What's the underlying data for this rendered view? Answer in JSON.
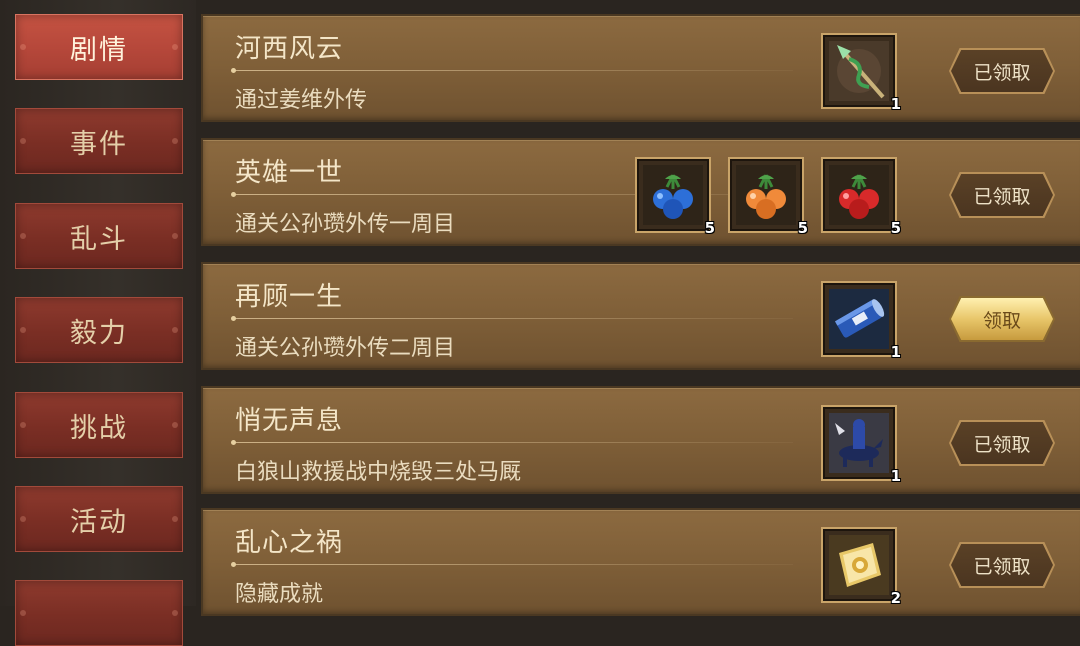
{
  "sidebar": {
    "tabs": [
      {
        "label": "剧情",
        "active": true
      },
      {
        "label": "事件",
        "active": false
      },
      {
        "label": "乱斗",
        "active": false
      },
      {
        "label": "毅力",
        "active": false
      },
      {
        "label": "挑战",
        "active": false
      },
      {
        "label": "活动",
        "active": false
      }
    ]
  },
  "achievements": [
    {
      "title": "河西风云",
      "desc": "通过姜维外传",
      "rewards": [
        {
          "icon": "spear-icon",
          "count": "1"
        }
      ],
      "button": "已领取",
      "claimed": true
    },
    {
      "title": "英雄一世",
      "desc": "通关公孙瓒外传一周目",
      "rewards": [
        {
          "icon": "blue-fruit-icon",
          "count": "5"
        },
        {
          "icon": "orange-fruit-icon",
          "count": "5"
        },
        {
          "icon": "red-fruit-icon",
          "count": "5"
        }
      ],
      "button": "已领取",
      "claimed": true
    },
    {
      "title": "再顾一生",
      "desc": "通关公孙瓒外传二周目",
      "rewards": [
        {
          "icon": "scroll-icon",
          "count": "1"
        }
      ],
      "button": "领取",
      "claimed": false
    },
    {
      "title": "悄无声息",
      "desc": "白狼山救援战中烧毁三处马厩",
      "rewards": [
        {
          "icon": "cavalry-icon",
          "count": "1"
        }
      ],
      "button": "已领取",
      "claimed": true
    },
    {
      "title": "乱心之祸",
      "desc": "隐藏成就",
      "rewards": [
        {
          "icon": "gold-ingot-icon",
          "count": "2"
        }
      ],
      "button": "已领取",
      "claimed": true
    }
  ],
  "colors": {
    "active_tab": "#b5473a",
    "inactive_tab": "#7a2e24",
    "row_bg": "#7f5f38",
    "claim_ready": "#e8c66a",
    "claimed": "#4b3520"
  }
}
